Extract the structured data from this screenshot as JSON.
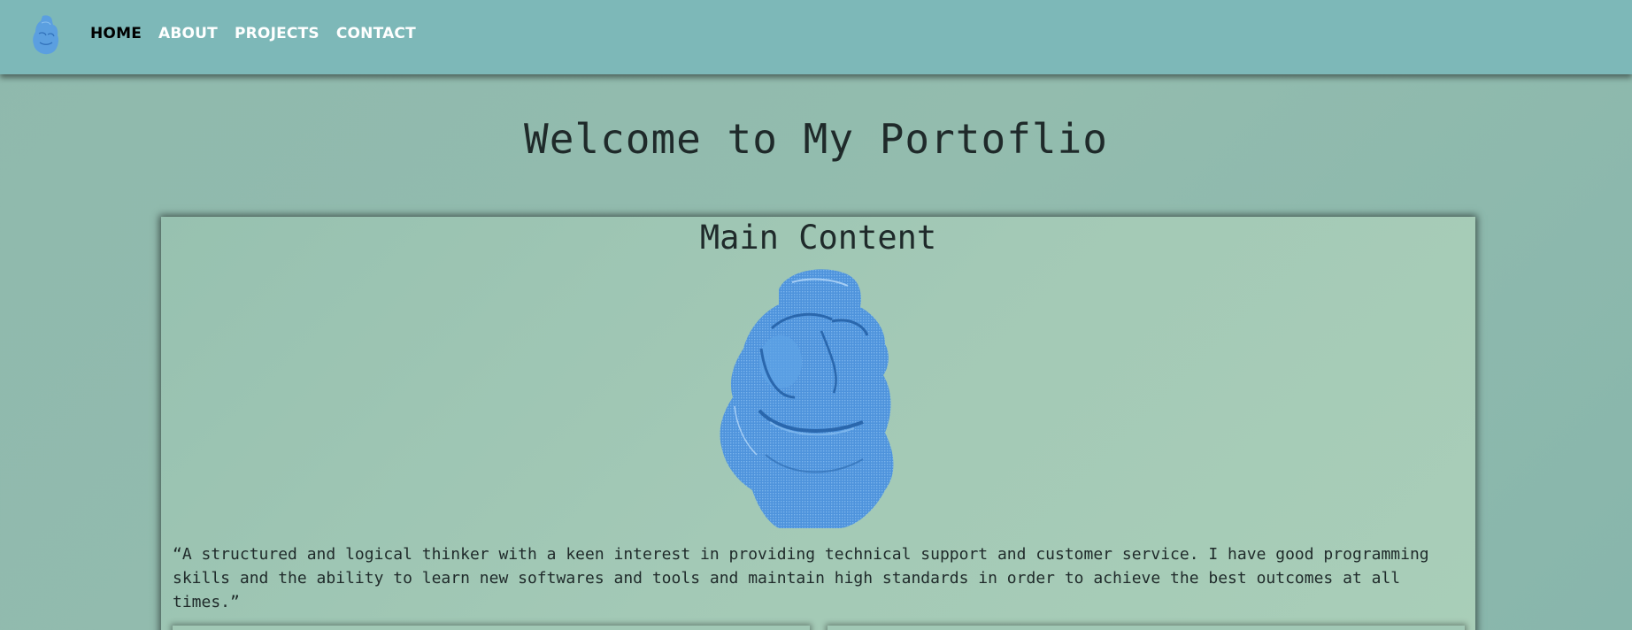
{
  "nav": {
    "logo_icon": "bust-logo-icon",
    "items": [
      {
        "label": "HOME",
        "active": true
      },
      {
        "label": "ABOUT",
        "active": false
      },
      {
        "label": "PROJECTS",
        "active": false
      },
      {
        "label": "CONTACT",
        "active": false
      }
    ]
  },
  "page": {
    "title": "Welcome to My Portoflio"
  },
  "main": {
    "title": "Main Content",
    "image_icon": "blue-bust-image",
    "quote": "“A structured and logical thinker with a keen interest in providing technical support and customer service. I have good programming skills and the ability to learn new softwares and tools and maintain high standards in order to achieve the best outcomes at all times.”"
  },
  "colors": {
    "navbar": "#7db8b8",
    "background": "#8fb9ad",
    "card": "#a3c9b6",
    "bust": "#4a90d9",
    "active_link": "#000000",
    "link": "#ffffff"
  }
}
